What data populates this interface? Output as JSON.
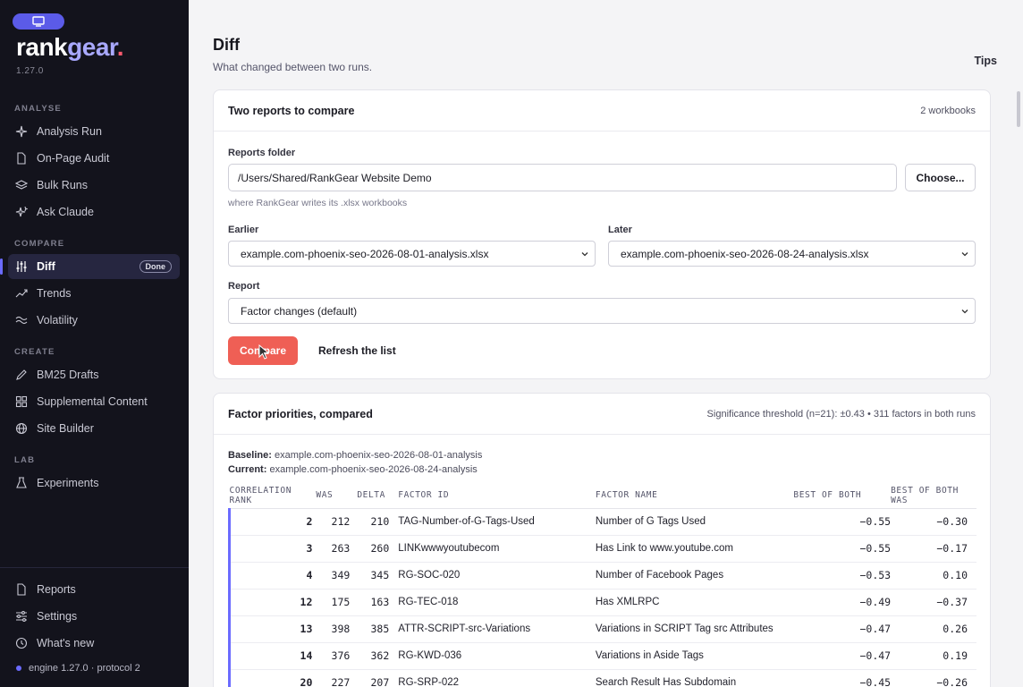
{
  "sidebar": {
    "brand": {
      "part1": "rank",
      "part2": "gear",
      "part3": "."
    },
    "version": "1.27.0",
    "sections": {
      "analyse": "ANALYSE",
      "compare": "COMPARE",
      "create": "CREATE",
      "lab": "LAB"
    },
    "items": {
      "analysis_run": "Analysis Run",
      "on_page_audit": "On-Page Audit",
      "bulk_runs": "Bulk Runs",
      "ask_claude": "Ask Claude",
      "diff": "Diff",
      "diff_badge": "Done",
      "trends": "Trends",
      "volatility": "Volatility",
      "bm25_drafts": "BM25 Drafts",
      "supplemental_content": "Supplemental Content",
      "site_builder": "Site Builder",
      "experiments": "Experiments",
      "reports": "Reports",
      "settings": "Settings",
      "whats_new": "What's new"
    },
    "engine_status": "engine 1.27.0 · protocol 2"
  },
  "header": {
    "title": "Diff",
    "subtitle": "What changed between two runs.",
    "tips": "Tips"
  },
  "compare_card": {
    "title": "Two reports to compare",
    "meta": "2 workbooks",
    "folder_label": "Reports folder",
    "folder_value": "/Users/Shared/RankGear Website Demo",
    "choose_label": "Choose...",
    "folder_hint": "where RankGear writes its .xlsx workbooks",
    "earlier_label": "Earlier",
    "earlier_value": "example.com-phoenix-seo-2026-08-01-analysis.xlsx",
    "later_label": "Later",
    "later_value": "example.com-phoenix-seo-2026-08-24-analysis.xlsx",
    "report_label": "Report",
    "report_value": "Factor changes (default)",
    "compare_label": "Compare",
    "refresh_label": "Refresh the list"
  },
  "priorities_card": {
    "title": "Factor priorities, compared",
    "meta": "Significance threshold (n=21): ±0.43 • 311 factors in both runs",
    "baseline_label": "Baseline:",
    "baseline_value": "example.com-phoenix-seo-2026-08-01-analysis",
    "current_label": "Current:",
    "current_value": "example.com-phoenix-seo-2026-08-24-analysis",
    "columns": [
      "CORRELATION RANK",
      "WAS",
      "DELTA",
      "FACTOR ID",
      "FACTOR NAME",
      "BEST OF BOTH",
      "BEST OF BOTH WAS"
    ],
    "rows": [
      [
        "2",
        "212",
        "210",
        "TAG-Number-of-G-Tags-Used",
        "Number of G Tags Used",
        "−0.55",
        "−0.30"
      ],
      [
        "3",
        "263",
        "260",
        "LINKwwwyoutubecom",
        "Has Link to www.youtube.com",
        "−0.55",
        "−0.17"
      ],
      [
        "4",
        "349",
        "345",
        "RG-SOC-020",
        "Number of Facebook Pages",
        "−0.53",
        "0.10"
      ],
      [
        "12",
        "175",
        "163",
        "RG-TEC-018",
        "Has XMLRPC",
        "−0.49",
        "−0.37"
      ],
      [
        "13",
        "398",
        "385",
        "ATTR-SCRIPT-src-Variations",
        "Variations in SCRIPT Tag src Attributes",
        "−0.47",
        "0.26"
      ],
      [
        "14",
        "376",
        "362",
        "RG-KWD-036",
        "Variations in Aside Tags",
        "−0.47",
        "0.19"
      ],
      [
        "20",
        "227",
        "207",
        "RG-SRP-022",
        "Search Result Has Subdomain",
        "−0.45",
        "−0.26"
      ]
    ]
  }
}
